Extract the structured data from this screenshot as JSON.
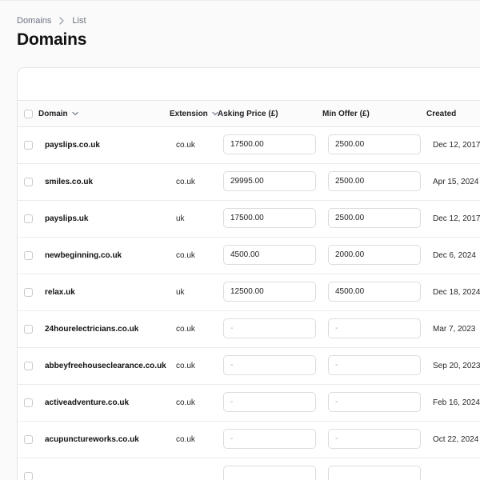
{
  "breadcrumb": [
    "Domains",
    "List"
  ],
  "page_title": "Domains",
  "table": {
    "columns": {
      "domain": "Domain",
      "extension": "Extension",
      "asking_price": "Asking Price (£)",
      "min_offer": "Min Offer (£)",
      "created": "Created"
    },
    "empty_placeholder": "-",
    "rows": [
      {
        "domain": "payslips.co.uk",
        "extension": "co.uk",
        "asking_price": "17500.00",
        "min_offer": "2500.00",
        "created": "Dec 12, 2017"
      },
      {
        "domain": "smiles.co.uk",
        "extension": "co.uk",
        "asking_price": "29995.00",
        "min_offer": "2500.00",
        "created": "Apr 15, 2024"
      },
      {
        "domain": "payslips.uk",
        "extension": "uk",
        "asking_price": "17500.00",
        "min_offer": "2500.00",
        "created": "Dec 12, 2017"
      },
      {
        "domain": "newbeginning.co.uk",
        "extension": "co.uk",
        "asking_price": "4500.00",
        "min_offer": "2000.00",
        "created": "Dec 6, 2024"
      },
      {
        "domain": "relax.uk",
        "extension": "uk",
        "asking_price": "12500.00",
        "min_offer": "4500.00",
        "created": "Dec 18, 2024"
      },
      {
        "domain": "24hourelectricians.co.uk",
        "extension": "co.uk",
        "asking_price": "",
        "min_offer": "",
        "created": "Mar 7, 2023"
      },
      {
        "domain": "abbeyfreehouseclearance.co.uk",
        "extension": "co.uk",
        "asking_price": "",
        "min_offer": "",
        "created": "Sep 20, 2023"
      },
      {
        "domain": "activeadventure.co.uk",
        "extension": "co.uk",
        "asking_price": "",
        "min_offer": "",
        "created": "Feb 16, 2024"
      },
      {
        "domain": "acupunctureworks.co.uk",
        "extension": "co.uk",
        "asking_price": "",
        "min_offer": "",
        "created": "Oct 22, 2024"
      }
    ]
  },
  "icons": {
    "breadcrumb_separator": "chevron-right-icon",
    "sort_indicator": "chevron-down-icon"
  },
  "colors": {
    "background": "#fafafa",
    "card": "#ffffff",
    "border": "#e6e6e9",
    "text": "#18181b",
    "muted": "#6b7280"
  }
}
